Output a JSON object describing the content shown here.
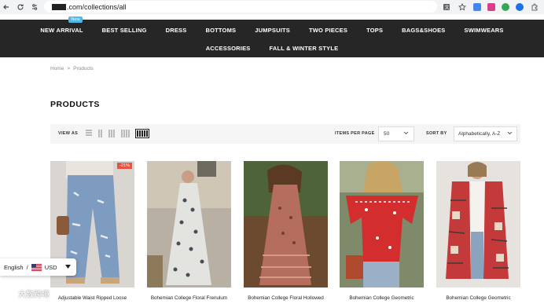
{
  "browser": {
    "url_text": ".com/collections/all"
  },
  "nav": {
    "row1": [
      {
        "label": "NEW ARRIVAL",
        "badge": "New"
      },
      {
        "label": "BEST SELLING"
      },
      {
        "label": "DRESS"
      },
      {
        "label": "BOTTOMS"
      },
      {
        "label": "JUMPSUITS"
      },
      {
        "label": "TWO PIECES"
      },
      {
        "label": "TOPS"
      },
      {
        "label": "BAGS&SHOES"
      },
      {
        "label": "SWIMWEARS"
      }
    ],
    "row2": [
      {
        "label": "ACCESSORIES"
      },
      {
        "label": "FALL & WINTER STYLE"
      }
    ]
  },
  "breadcrumb": {
    "home": "Home",
    "separator": ">",
    "current": "Products"
  },
  "page_title": "PRODUCTS",
  "toolbar": {
    "view_label": "VIEW AS",
    "items_per_page_label": "ITEMS PER PAGE",
    "items_per_page_value": "50",
    "sort_label": "SORT BY",
    "sort_value": "Alphabetically, A-Z"
  },
  "products": [
    {
      "name": "Adjustable Waist Ripped Loose",
      "badge": "-21%"
    },
    {
      "name": "Bohemian College Floral Frenulum",
      "badge": ""
    },
    {
      "name": "Bohemian College Floral Hollowed",
      "badge": ""
    },
    {
      "name": "Bohemian College Geometric",
      "badge": ""
    },
    {
      "name": "Bohemian College Geometric",
      "badge": ""
    }
  ],
  "currency": {
    "language": "English",
    "separator": "/",
    "currency": "USD"
  },
  "watermark": "大数跨境",
  "colors": {
    "nav_bg": "#262626",
    "badge_new": "#4fb8e6",
    "badge_sale": "#e8533f"
  }
}
